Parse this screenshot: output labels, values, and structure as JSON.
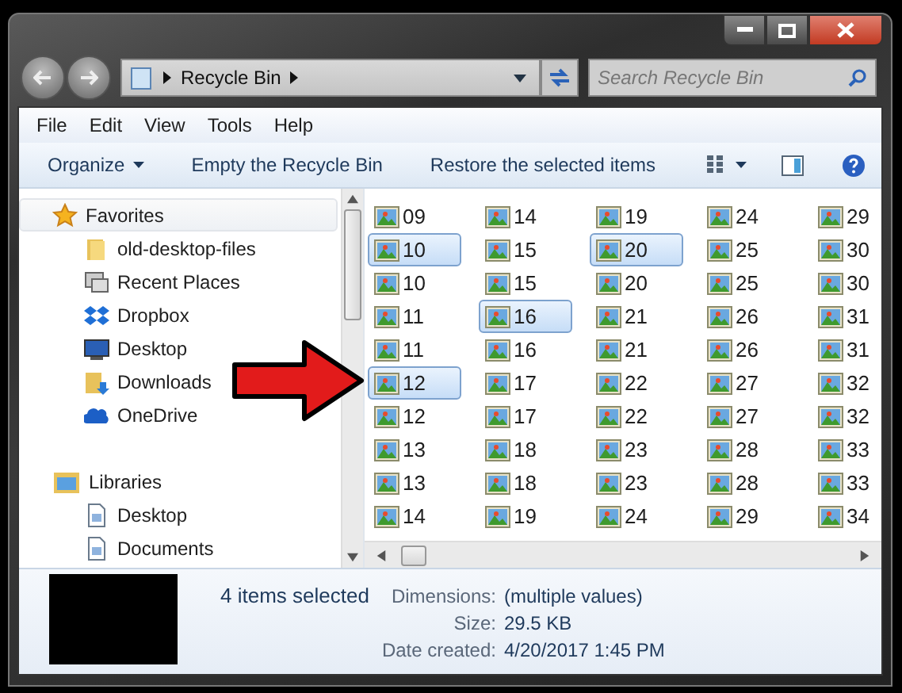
{
  "address": {
    "location": "Recycle Bin"
  },
  "search": {
    "placeholder": "Search Recycle Bin"
  },
  "menu": [
    "File",
    "Edit",
    "View",
    "Tools",
    "Help"
  ],
  "toolbar": [
    {
      "label": "Organize",
      "dropdown": true
    },
    {
      "label": "Empty the Recycle Bin",
      "dropdown": false
    },
    {
      "label": "Restore the selected items",
      "dropdown": false
    }
  ],
  "navigation": [
    {
      "label": "Favorites",
      "kind": "star",
      "selected": true,
      "children": [
        {
          "label": "old-desktop-files",
          "kind": "folder"
        },
        {
          "label": "Recent Places",
          "kind": "recent"
        },
        {
          "label": "Dropbox",
          "kind": "dropbox"
        },
        {
          "label": "Desktop",
          "kind": "desktop"
        },
        {
          "label": "Downloads",
          "kind": "downloads"
        },
        {
          "label": "OneDrive",
          "kind": "cloud"
        }
      ]
    },
    {
      "label": "Libraries",
      "kind": "library",
      "selected": false,
      "children": [
        {
          "label": "Desktop",
          "kind": "document"
        },
        {
          "label": "Documents",
          "kind": "document"
        }
      ]
    }
  ],
  "files": [
    [
      {
        "name": "09",
        "selected": false
      },
      {
        "name": "10",
        "selected": true
      },
      {
        "name": "10",
        "selected": false
      },
      {
        "name": "11",
        "selected": false
      },
      {
        "name": "11",
        "selected": false
      },
      {
        "name": "12",
        "selected": true
      },
      {
        "name": "12",
        "selected": false
      },
      {
        "name": "13",
        "selected": false
      },
      {
        "name": "13",
        "selected": false
      },
      {
        "name": "14",
        "selected": false
      }
    ],
    [
      {
        "name": "14",
        "selected": false
      },
      {
        "name": "15",
        "selected": false
      },
      {
        "name": "15",
        "selected": false
      },
      {
        "name": "16",
        "selected": true
      },
      {
        "name": "16",
        "selected": false
      },
      {
        "name": "17",
        "selected": false
      },
      {
        "name": "17",
        "selected": false
      },
      {
        "name": "18",
        "selected": false
      },
      {
        "name": "18",
        "selected": false
      },
      {
        "name": "19",
        "selected": false
      }
    ],
    [
      {
        "name": "19",
        "selected": false
      },
      {
        "name": "20",
        "selected": true
      },
      {
        "name": "20",
        "selected": false
      },
      {
        "name": "21",
        "selected": false
      },
      {
        "name": "21",
        "selected": false
      },
      {
        "name": "22",
        "selected": false
      },
      {
        "name": "22",
        "selected": false
      },
      {
        "name": "23",
        "selected": false
      },
      {
        "name": "23",
        "selected": false
      },
      {
        "name": "24",
        "selected": false
      }
    ],
    [
      {
        "name": "24",
        "selected": false
      },
      {
        "name": "25",
        "selected": false
      },
      {
        "name": "25",
        "selected": false
      },
      {
        "name": "26",
        "selected": false
      },
      {
        "name": "26",
        "selected": false
      },
      {
        "name": "27",
        "selected": false
      },
      {
        "name": "27",
        "selected": false
      },
      {
        "name": "28",
        "selected": false
      },
      {
        "name": "28",
        "selected": false
      },
      {
        "name": "29",
        "selected": false
      }
    ],
    [
      {
        "name": "29",
        "selected": false
      },
      {
        "name": "30",
        "selected": false
      },
      {
        "name": "30",
        "selected": false
      },
      {
        "name": "31",
        "selected": false
      },
      {
        "name": "31",
        "selected": false
      },
      {
        "name": "32",
        "selected": false
      },
      {
        "name": "32",
        "selected": false
      },
      {
        "name": "33",
        "selected": false
      },
      {
        "name": "33",
        "selected": false
      },
      {
        "name": "34",
        "selected": false
      }
    ]
  ],
  "details": {
    "summary": "4 items selected",
    "properties": [
      {
        "label": "Dimensions:",
        "value": "(multiple values)"
      },
      {
        "label": "Size:",
        "value": "29.5 KB"
      },
      {
        "label": "Date created:",
        "value": "4/20/2017 1:45 PM"
      }
    ]
  },
  "annotation": {
    "kind": "arrow"
  }
}
